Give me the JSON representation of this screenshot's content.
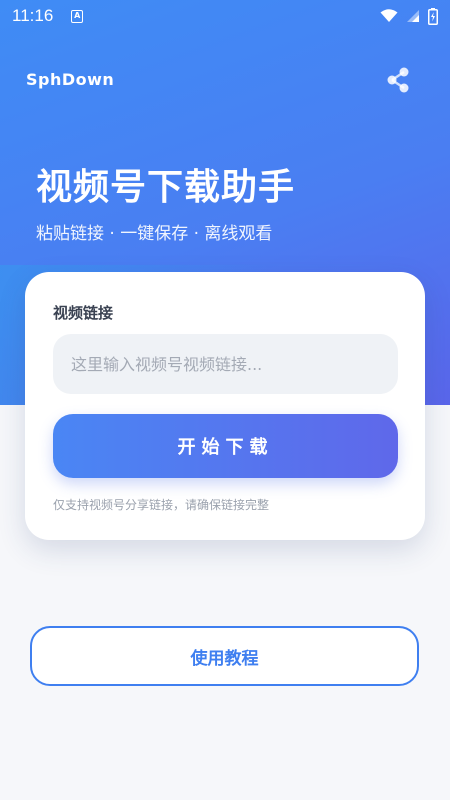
{
  "status_bar": {
    "time": "11:16",
    "notification_icon": "a-letter-icon",
    "icons": [
      "wifi-icon",
      "signal-icon",
      "battery-icon"
    ]
  },
  "header": {
    "app_name": "SphDown",
    "share_icon": "share-icon"
  },
  "hero": {
    "title": "视频号下载助手",
    "subtitle": "粘贴链接 · 一键保存 · 离线观看"
  },
  "card": {
    "field_label": "视频链接",
    "input_value": "",
    "input_placeholder": "这里输入视频号视频链接...",
    "download_label": "开始下载",
    "hint": "仅支持视频号分享链接，请确保链接完整"
  },
  "footer": {
    "tutorial_label": "使用教程"
  },
  "colors": {
    "primary": "#3f7ff0",
    "gradient_start": "#4a86f4",
    "gradient_end": "#5f68ea",
    "background": "#f6f7fa"
  }
}
